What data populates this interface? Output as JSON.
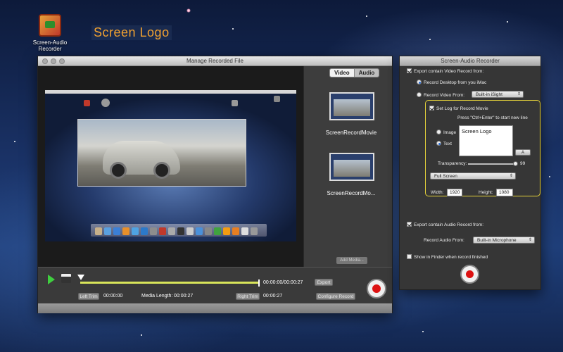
{
  "desktop": {
    "app_icon_label": "Screen-Audio Recorder",
    "overlay_logo_text": "Screen Logo"
  },
  "main_window": {
    "title": "Manage Recorded File",
    "tabs": [
      {
        "label": "Video",
        "selected": true
      },
      {
        "label": "Audio",
        "selected": false
      }
    ],
    "media_items": [
      {
        "label": "ScreenRecordMovie"
      },
      {
        "label": "ScreenRecordMo..."
      }
    ],
    "add_media_label": "Add Media...",
    "time_readout": "00:00:00/00:00:27",
    "export_label": "Export",
    "left_trim_label": "Left Trim",
    "left_trim_time": "00:00:00",
    "media_length_label": "Media Length:",
    "media_length_value": "00:00:27",
    "right_trim_label": "Right Trim",
    "right_trim_time": "00:00:27",
    "configure_record_label": "Configure Record"
  },
  "recorder_window": {
    "title": "Screen-Audio Recorder",
    "export_video_label": "Export contain Video Record from:",
    "record_desktop_label": "Record Desktop from you iMac",
    "record_video_label": "Record Video From:",
    "record_video_source": "Built-in iSight",
    "set_log_label": "Set Log for Record Movie",
    "hint_text": "Press \"Ctrl+Enter\" to start new line",
    "image_option": "Image",
    "text_option": "Text",
    "log_text": "Screen Logo",
    "font_button_label": "A",
    "transparency_label": "Transparency:",
    "transparency_value": "99",
    "size_mode": "Full Screen",
    "width_label": "Width:",
    "width_value": "1920",
    "height_label": "Height:",
    "height_value": "1080",
    "export_audio_label": "Export contain Audio Record from:",
    "record_audio_label": "Record Audio From:",
    "record_audio_source": "Built-in Microphone",
    "show_in_finder_label": "Show in Finder when record finished"
  },
  "colors": {
    "accent_green": "#3fcf3f",
    "record_red": "#d11111",
    "highlight_yellow": "#e6d33a",
    "logo_orange": "#f2a230"
  }
}
